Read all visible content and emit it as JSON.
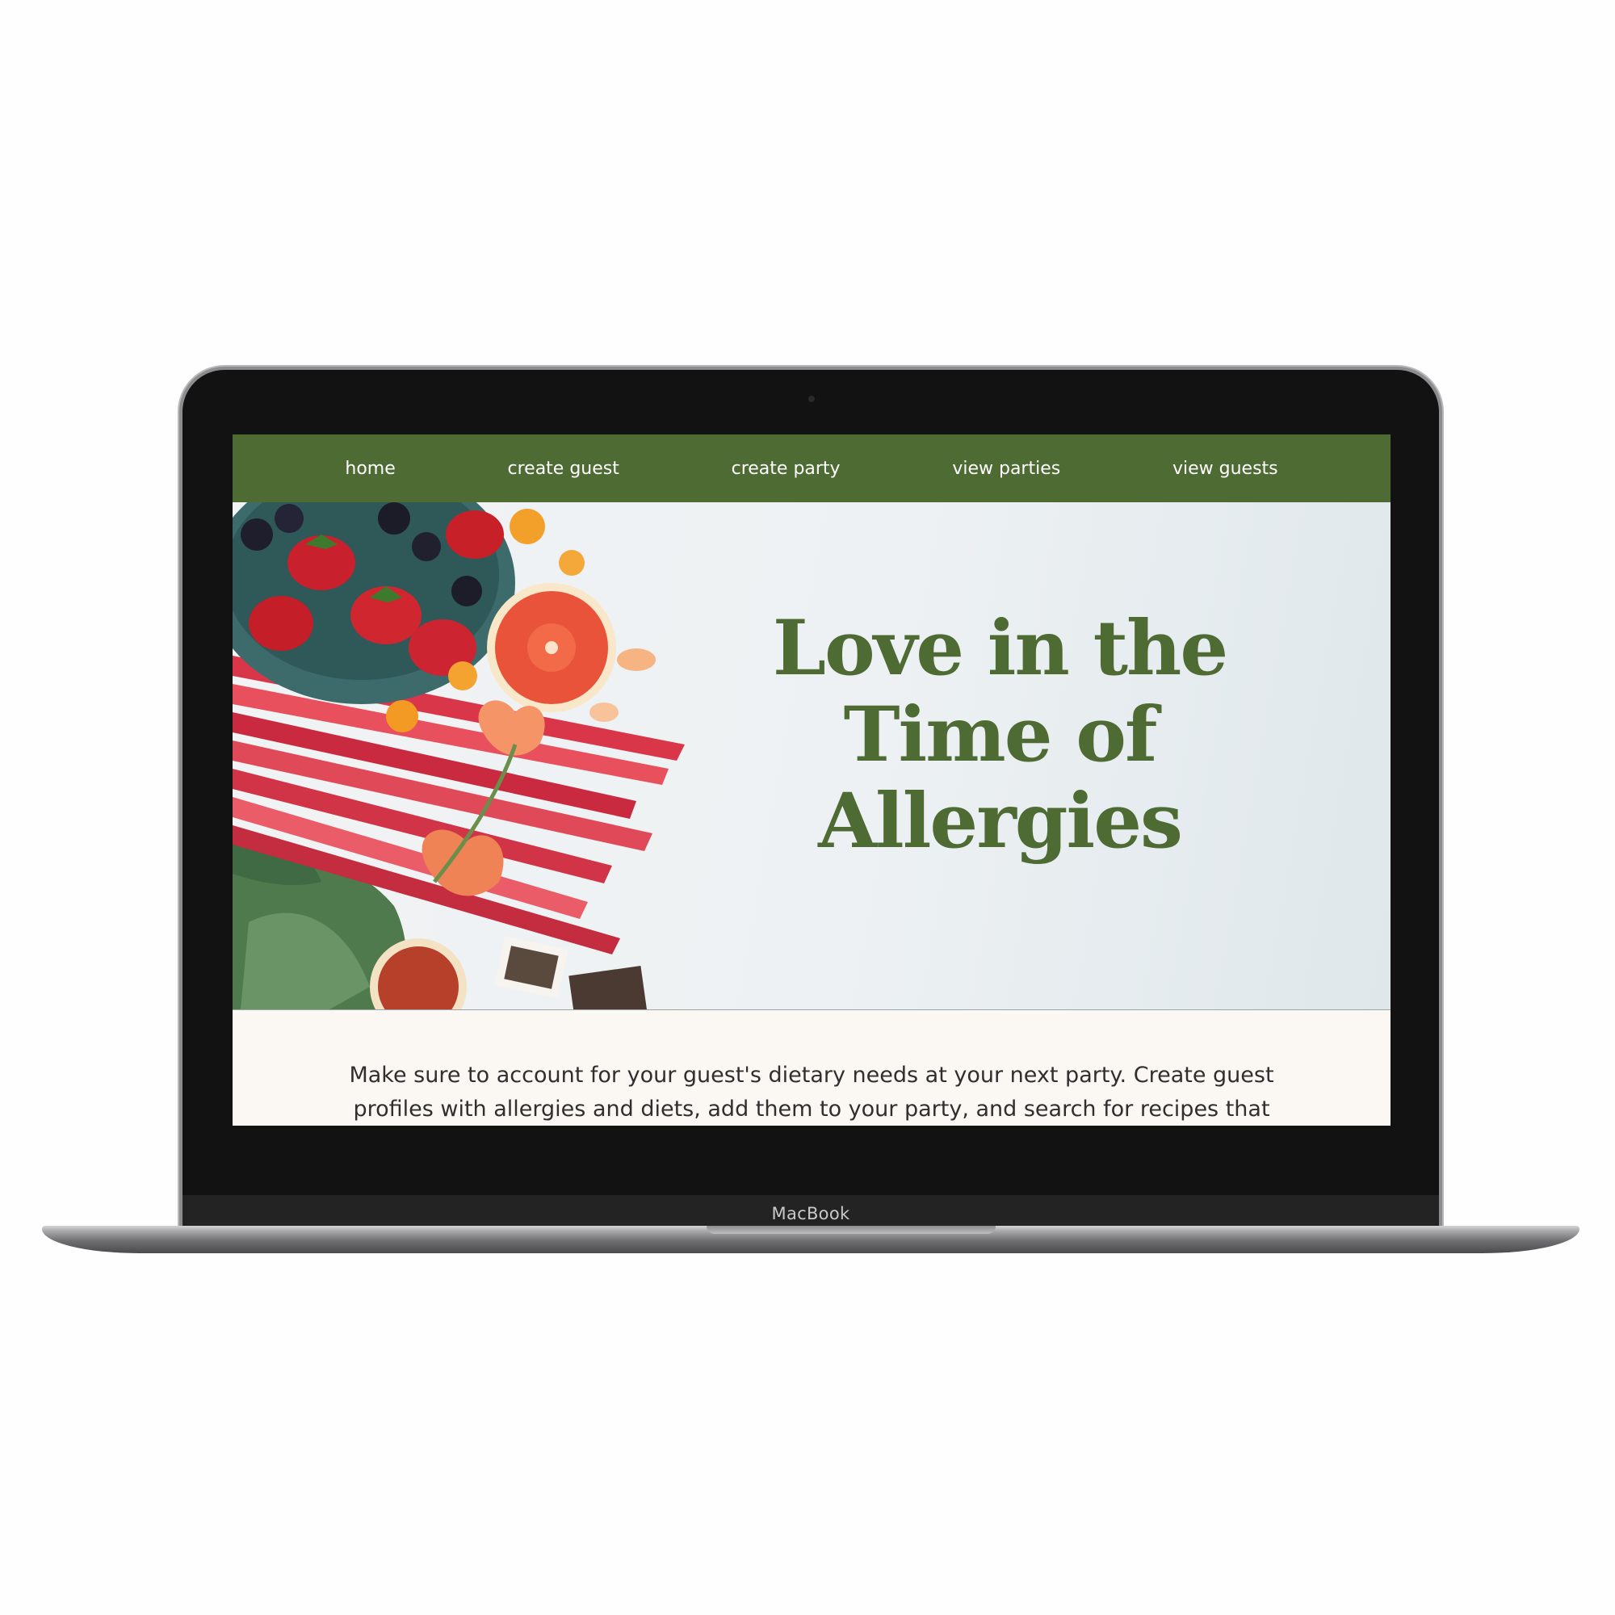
{
  "nav": {
    "items": [
      {
        "label": "home"
      },
      {
        "label": "create guest"
      },
      {
        "label": "create party"
      },
      {
        "label": "view parties"
      },
      {
        "label": "view guests"
      }
    ]
  },
  "hero": {
    "title_lines": [
      "Love in the",
      "Time of",
      "Allergies"
    ],
    "image_subject": "fruit-and-flowers-photo"
  },
  "intro": {
    "text": "Make sure to account for your guest's dietary needs at your next party. Create guest profiles with allergies and diets, add them to your party, and search for recipes that will accomodate their needs."
  },
  "device": {
    "label": "MacBook"
  },
  "colors": {
    "brand_green": "#4e6b34",
    "page_background": "#fbf8f4",
    "bezel": "#121212"
  }
}
